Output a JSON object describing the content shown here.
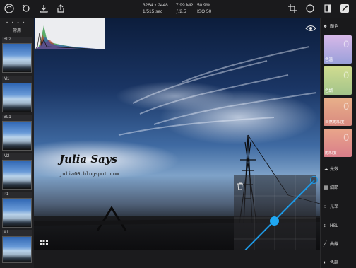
{
  "toolbar": {
    "icons": [
      "app-logo-icon",
      "undo-icon",
      "import-icon",
      "share-icon",
      "crop-icon",
      "circle-icon",
      "compare-icon",
      "enhance-icon"
    ]
  },
  "meta": {
    "resolution": "3264 x 2448",
    "shutter": "1/515 sec",
    "megapixels": "7.99 MP",
    "aperture": "ƒ/2.5",
    "zoom": "50.9%",
    "iso": "ISO 50"
  },
  "filmstrip": {
    "dots": "• • • •",
    "title": "常用",
    "presets": [
      {
        "label": "BL2"
      },
      {
        "label": "M1"
      },
      {
        "label": "BL1"
      },
      {
        "label": "M2"
      },
      {
        "label": "P1"
      },
      {
        "label": "A1"
      }
    ]
  },
  "photo": {
    "watermark_title": "Julia Says",
    "watermark_sub": "julia00.blogspot.com"
  },
  "right_panel": {
    "header": "顏色",
    "cards": [
      {
        "label": "色溫",
        "value": "0",
        "color": "#a7a9d6"
      },
      {
        "label": "色調",
        "value": "0",
        "color": "#bfcf8a"
      },
      {
        "label": "自然飽和度",
        "value": "0",
        "color": "#e19a88"
      },
      {
        "label": "飽和度",
        "value": "0",
        "color": "#d98c8c"
      }
    ],
    "items": [
      {
        "label": "光效",
        "icon": "☁"
      },
      {
        "label": "細節",
        "icon": "▦"
      },
      {
        "label": "光學",
        "icon": "○"
      },
      {
        "label": "HSL",
        "icon": "↕"
      },
      {
        "label": "曲線",
        "icon": "╱"
      },
      {
        "label": "色調",
        "icon": "◐"
      }
    ]
  }
}
